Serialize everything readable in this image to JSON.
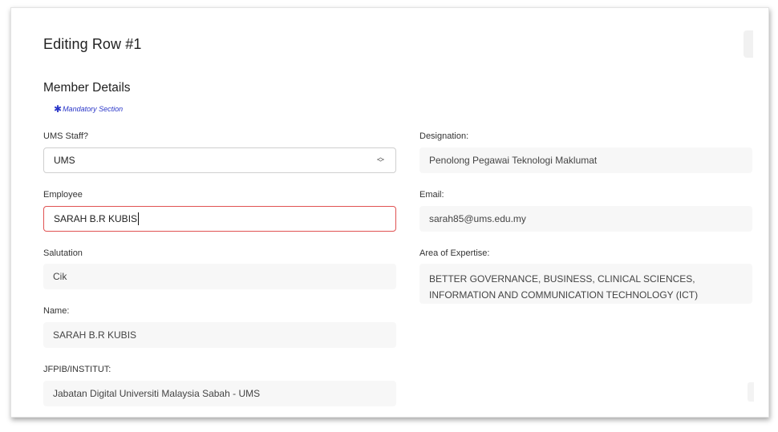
{
  "page": {
    "title": "Editing Row #1",
    "section_title": "Member Details",
    "mandatory_note": "Mandatory Section"
  },
  "left": {
    "ums_staff": {
      "label": "UMS Staff?",
      "value": "UMS"
    },
    "employee": {
      "label": "Employee",
      "value": "SARAH B.R KUBIS"
    },
    "salutation": {
      "label": "Salutation",
      "value": "Cik"
    },
    "name": {
      "label": "Name:",
      "value": "SARAH B.R KUBIS"
    },
    "jfpib": {
      "label": "JFPIB/INSTITUT:",
      "value": "Jabatan Digital Universiti Malaysia Sabah - UMS"
    }
  },
  "right": {
    "designation": {
      "label": "Designation:",
      "value": "Penolong Pegawai Teknologi Maklumat"
    },
    "email": {
      "label": "Email:",
      "value": "sarah85@ums.edu.my"
    },
    "expertise": {
      "label": "Area of Expertise:",
      "value": "BETTER GOVERNANCE, BUSINESS, CLINICAL SCIENCES, INFORMATION AND COMMUNICATION TECHNOLOGY (ICT)"
    }
  },
  "icons": {
    "mandatory": "asterisk-icon",
    "select": "chevron-up-down-icon"
  },
  "colors": {
    "mandatory": "#2a36c8",
    "error_border": "#e05252"
  }
}
